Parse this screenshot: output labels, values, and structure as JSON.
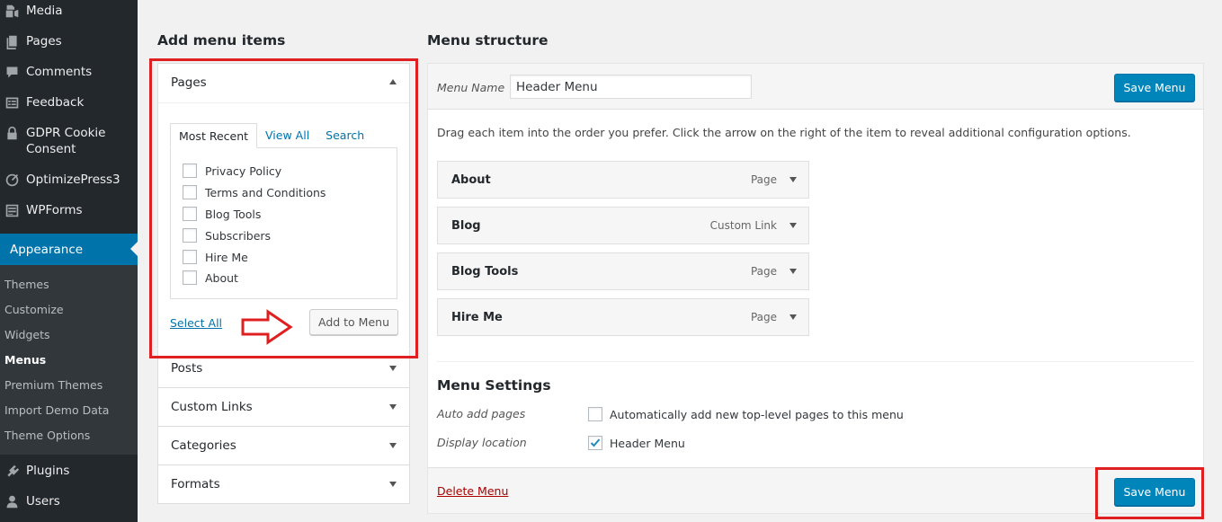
{
  "sidebar": {
    "items_top": [
      {
        "label": "Media",
        "icon": "media-icon"
      },
      {
        "label": "Pages",
        "icon": "pages-icon"
      },
      {
        "label": "Comments",
        "icon": "comments-icon"
      },
      {
        "label": "Feedback",
        "icon": "feedback-icon"
      },
      {
        "label": "GDPR Cookie Consent",
        "icon": "lock-icon"
      },
      {
        "label": "OptimizePress3",
        "icon": "optimizepress-icon"
      },
      {
        "label": "WPForms",
        "icon": "wpforms-icon"
      }
    ],
    "gdpr_line1": "GDPR Cookie",
    "gdpr_line2": "Consent",
    "appearance": {
      "label": "Appearance",
      "icon": "paintbrush-icon"
    },
    "submenu": [
      "Themes",
      "Customize",
      "Widgets",
      "Menus",
      "Premium Themes",
      "Import Demo Data",
      "Theme Options"
    ],
    "current_submenu": "Menus",
    "items_bottom": [
      {
        "label": "Plugins",
        "icon": "plugin-icon"
      },
      {
        "label": "Users",
        "icon": "users-icon"
      }
    ]
  },
  "add_items": {
    "heading": "Add menu items",
    "pages": {
      "title": "Pages",
      "tabs": [
        "Most Recent",
        "View All",
        "Search"
      ],
      "active_tab": "Most Recent",
      "checklist": [
        "Privacy Policy",
        "Terms and Conditions",
        "Blog Tools",
        "Subscribers",
        "Hire Me",
        "About"
      ],
      "select_all": "Select All",
      "add_button": "Add to Menu"
    },
    "other_sections": [
      "Posts",
      "Custom Links",
      "Categories",
      "Formats"
    ]
  },
  "structure": {
    "heading": "Menu structure",
    "menu_name_label": "Menu Name",
    "menu_name_value": "Header Menu",
    "save_button": "Save Menu",
    "instructions": "Drag each item into the order you prefer. Click the arrow on the right of the item to reveal additional configuration options.",
    "items": [
      {
        "title": "About",
        "type": "Page"
      },
      {
        "title": "Blog",
        "type": "Custom Link"
      },
      {
        "title": "Blog Tools",
        "type": "Page"
      },
      {
        "title": "Hire Me",
        "type": "Page"
      }
    ],
    "settings": {
      "title": "Menu Settings",
      "auto_add_label": "Auto add pages",
      "auto_add_text": "Automatically add new top-level pages to this menu",
      "auto_add_checked": false,
      "display_label": "Display location",
      "display_text": "Header Menu",
      "display_checked": true
    },
    "delete_link": "Delete Menu"
  },
  "colors": {
    "sidebar_bg": "#23282d",
    "accent": "#0073aa",
    "primary_button": "#0085ba",
    "annotation_red": "#e02020",
    "delete_red": "#aa0000"
  }
}
